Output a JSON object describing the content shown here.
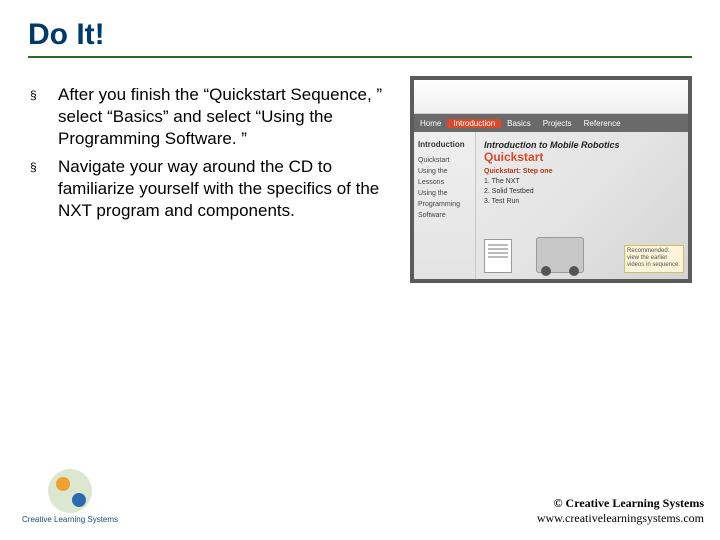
{
  "title": "Do It!",
  "bullets": [
    "After you finish the “Quickstart Sequence, ” select “Basics” and select “Using the Programming Software. ”",
    "Navigate your way around the CD to familiarize yourself with the specifics of the NXT program and components."
  ],
  "thumb": {
    "tabs": {
      "a": "Home",
      "b": "Introduction",
      "c": "Basics",
      "d": "Projects",
      "e": "Reference"
    },
    "side": {
      "head": "Introduction",
      "items": [
        "Quickstart",
        "Using the Lessons",
        "Using the Programming Software"
      ]
    },
    "main": {
      "title": "Introduction to Mobile Robotics",
      "sub": "Quickstart",
      "step_head": "Quickstart: Step one",
      "steps": [
        "1. The NXT",
        "2. Solid Testbed",
        "3. Test Run"
      ],
      "note": "Recommended: view the earlier videos in sequence."
    }
  },
  "footer": {
    "logo": "Creative Learning Systems",
    "copy": "© Creative Learning Systems",
    "url": "www.creativelearningsystems.com"
  }
}
